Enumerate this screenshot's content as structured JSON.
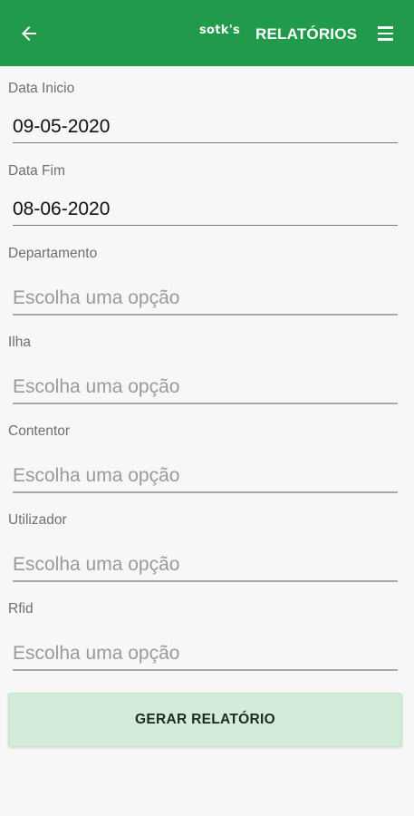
{
  "header": {
    "back_icon": "arrow-back-icon",
    "logo_text": "sotk's",
    "title": "RELATÓRIOS",
    "menu_icon": "hamburger-menu-icon",
    "background_color": "#219a4b"
  },
  "form": {
    "data_inicio": {
      "label": "Data Inicio",
      "value": "09-05-2020"
    },
    "data_fim": {
      "label": "Data Fim",
      "value": "08-06-2020"
    },
    "departamento": {
      "label": "Departamento",
      "placeholder": "Escolha uma opção"
    },
    "ilha": {
      "label": "Ilha",
      "placeholder": "Escolha uma opção"
    },
    "contentor": {
      "label": "Contentor",
      "placeholder": "Escolha uma opção"
    },
    "utilizador": {
      "label": "Utilizador",
      "placeholder": "Escolha uma opção"
    },
    "rfid": {
      "label": "Rfid",
      "placeholder": "Escolha uma opção"
    }
  },
  "actions": {
    "generate_label": "GERAR RELATÓRIO"
  }
}
